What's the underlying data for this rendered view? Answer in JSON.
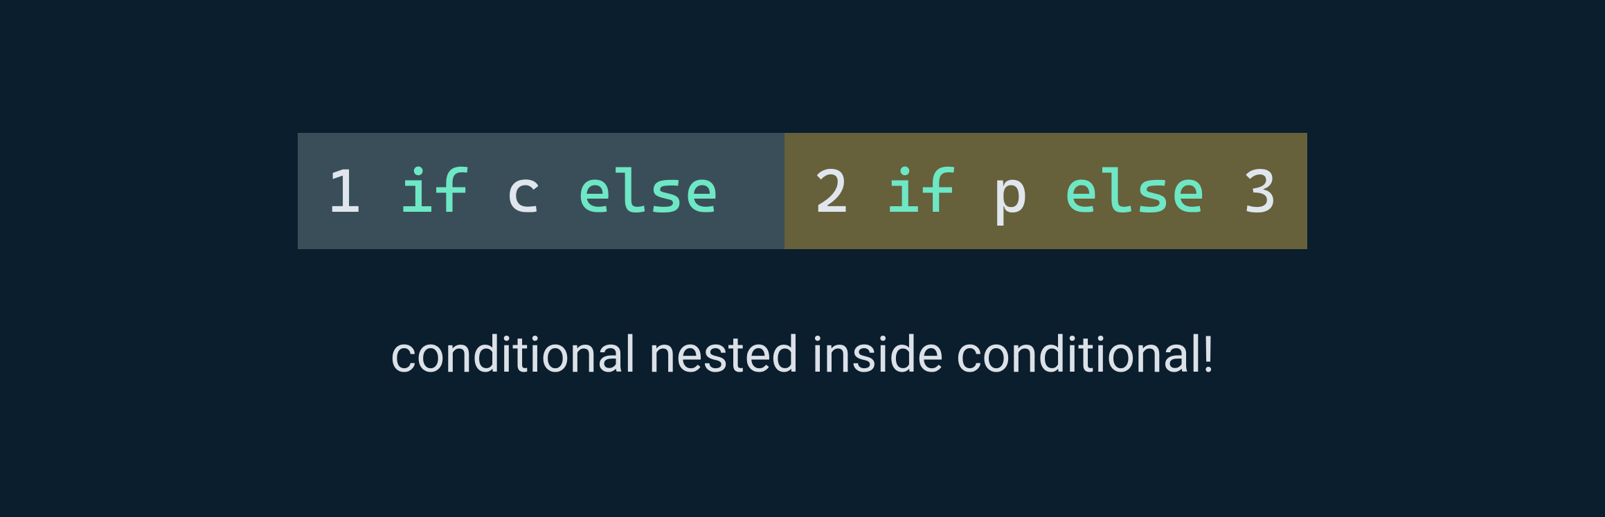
{
  "code": {
    "left": {
      "value1": "1",
      "keyword_if": "if",
      "variable": "c",
      "keyword_else": "else"
    },
    "right": {
      "value2": "2",
      "keyword_if": "if",
      "variable": "p",
      "keyword_else": "else",
      "value3": "3"
    }
  },
  "caption": "conditional nested inside conditional!"
}
